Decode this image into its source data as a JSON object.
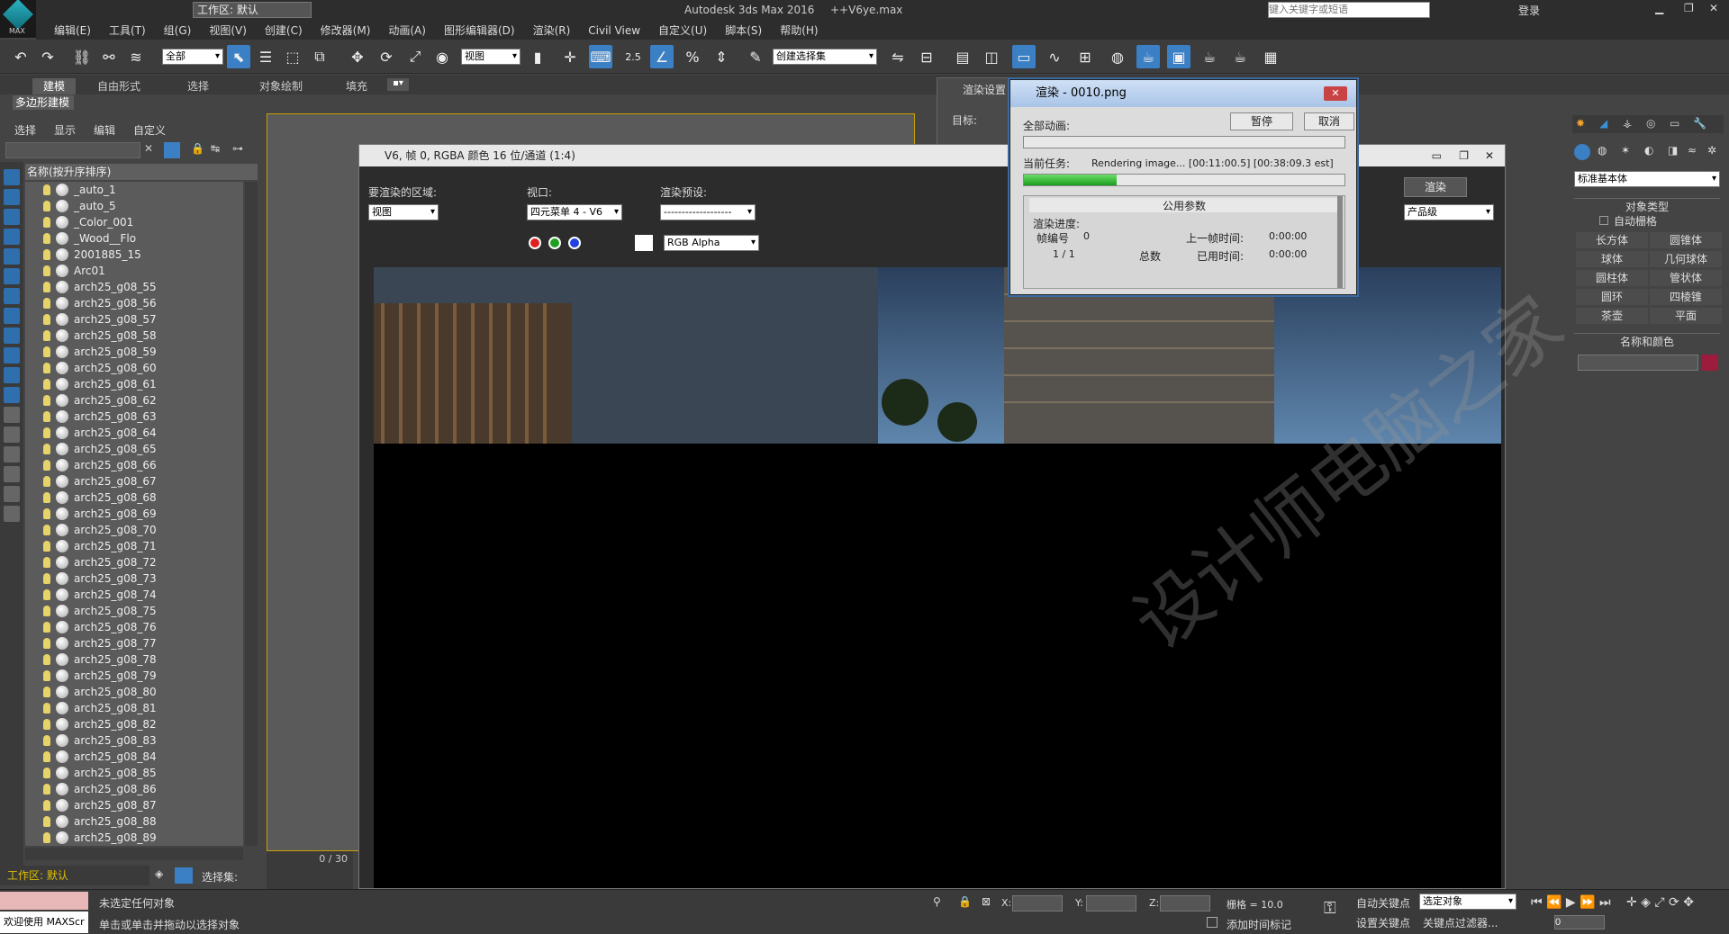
{
  "app": {
    "title": "Autodesk 3ds Max 2016",
    "file": "++V6ye.max",
    "workspace": "工作区: 默认",
    "logo_text": "MAX"
  },
  "search": {
    "placeholder": "键入关键字或短语"
  },
  "account": {
    "login": "登录"
  },
  "menus": [
    "编辑(E)",
    "工具(T)",
    "组(G)",
    "视图(V)",
    "创建(C)",
    "修改器(M)",
    "动画(A)",
    "图形编辑器(D)",
    "渲染(R)",
    "Civil View",
    "自定义(U)",
    "脚本(S)",
    "帮助(H)"
  ],
  "toolbar": {
    "filter": "全部",
    "view": "视图",
    "selection_set": "创建选择集",
    "snap_value": "2.5"
  },
  "ribbon": {
    "tabs": [
      "建模",
      "自由形式",
      "选择",
      "对象绘制",
      "填充"
    ],
    "sub": "多边形建模"
  },
  "scene_explorer": {
    "tabs": [
      "选择",
      "显示",
      "编辑",
      "自定义"
    ],
    "column_header": "名称(按升序排序)",
    "items": [
      "_auto_1",
      "_auto_5",
      "_Color_001",
      "_Wood__Flo",
      "2001885_15",
      "Arc01",
      "arch25_g08_55",
      "arch25_g08_56",
      "arch25_g08_57",
      "arch25_g08_58",
      "arch25_g08_59",
      "arch25_g08_60",
      "arch25_g08_61",
      "arch25_g08_62",
      "arch25_g08_63",
      "arch25_g08_64",
      "arch25_g08_65",
      "arch25_g08_66",
      "arch25_g08_67",
      "arch25_g08_68",
      "arch25_g08_69",
      "arch25_g08_70",
      "arch25_g08_71",
      "arch25_g08_72",
      "arch25_g08_73",
      "arch25_g08_74",
      "arch25_g08_75",
      "arch25_g08_76",
      "arch25_g08_77",
      "arch25_g08_78",
      "arch25_g08_79",
      "arch25_g08_80",
      "arch25_g08_81",
      "arch25_g08_82",
      "arch25_g08_83",
      "arch25_g08_84",
      "arch25_g08_85",
      "arch25_g08_86",
      "arch25_g08_87",
      "arch25_g08_88",
      "arch25_g08_89"
    ],
    "workspace_label": "工作区: 默认",
    "selection_set_label": "选择集:"
  },
  "frame_window": {
    "title": "V6, 帧 0, RGBA 颜色 16 位/通道 (1:4)",
    "area_label": "要渲染的区域:",
    "area_value": "视图",
    "viewport_label": "视口:",
    "viewport_value": "四元菜单 4 - V6",
    "preset_label": "渲染预设:",
    "preset_value": "-------------------",
    "render_button": "渲染",
    "product_value": "产品级",
    "channel_value": "RGB Alpha"
  },
  "render_setup": {
    "title": "渲染设置",
    "target_label": "目标:"
  },
  "render_dialog": {
    "title": "渲染 - 0010.png",
    "all_anim_label": "全部动画:",
    "pause": "暂停",
    "cancel": "取消",
    "current_task_label": "当前任务:",
    "current_task_value": "Rendering image... [00:11:00.5] [00:38:09.3 est]",
    "current_progress": 0.29,
    "common_params": "公用参数",
    "progress_label": "渲染进度:",
    "frame_label": "帧编号",
    "frame_value": "0",
    "frames": "1 / 1",
    "total_label": "总数",
    "last_frame_time_label": "上一帧时间:",
    "last_frame_time": "0:00:00",
    "elapsed_label": "已用时间:",
    "elapsed": "0:00:00"
  },
  "command_panel": {
    "category": "标准基本体",
    "object_type_header": "对象类型",
    "autogrid": "自动栅格",
    "objects": [
      "长方体",
      "圆锥体",
      "球体",
      "几何球体",
      "圆柱体",
      "管状体",
      "圆环",
      "四棱锥",
      "茶壶",
      "平面"
    ],
    "name_color_header": "名称和颜色",
    "color": "#9b1c3c"
  },
  "timeline": {
    "frame": "0 / 30"
  },
  "status": {
    "welcome": "欢迎使用 MAXScr",
    "line1": "未选定任何对象",
    "line2": "单击或单击并拖动以选择对象",
    "x_label": "X:",
    "y_label": "Y:",
    "z_label": "Z:",
    "grid": "栅格 = 10.0",
    "add_time_tag": "添加时间标记",
    "auto_key": "自动关键点",
    "set_key": "设置关键点",
    "selected_object": "选定对象",
    "key_filters": "关键点过滤器...",
    "frame_field": "0"
  },
  "watermark": "设计师电脑之家"
}
